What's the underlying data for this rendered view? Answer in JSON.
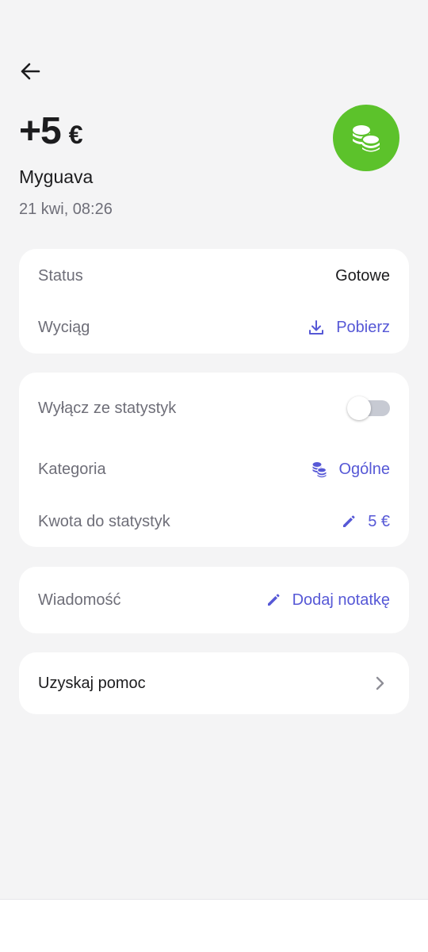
{
  "header": {
    "amount": "+5",
    "currency": "€",
    "merchant": "Myguava",
    "date": "21 kwi, 08:26",
    "category_icon": "coins-icon",
    "category_color": "#5cc22b"
  },
  "details": {
    "status_label": "Status",
    "status_value": "Gotowe",
    "statement_label": "Wyciąg",
    "statement_action": "Pobierz"
  },
  "stats": {
    "exclude_label": "Wyłącz ze statystyk",
    "exclude_enabled": false,
    "category_label": "Kategoria",
    "category_value": "Ogólne",
    "amount_label": "Kwota do statystyk",
    "amount_value": "5 €"
  },
  "message": {
    "label": "Wiadomość",
    "action": "Dodaj notatkę"
  },
  "help": {
    "label": "Uzyskaj pomoc"
  },
  "colors": {
    "accent": "#5658d6",
    "background": "#f4f4f5"
  }
}
